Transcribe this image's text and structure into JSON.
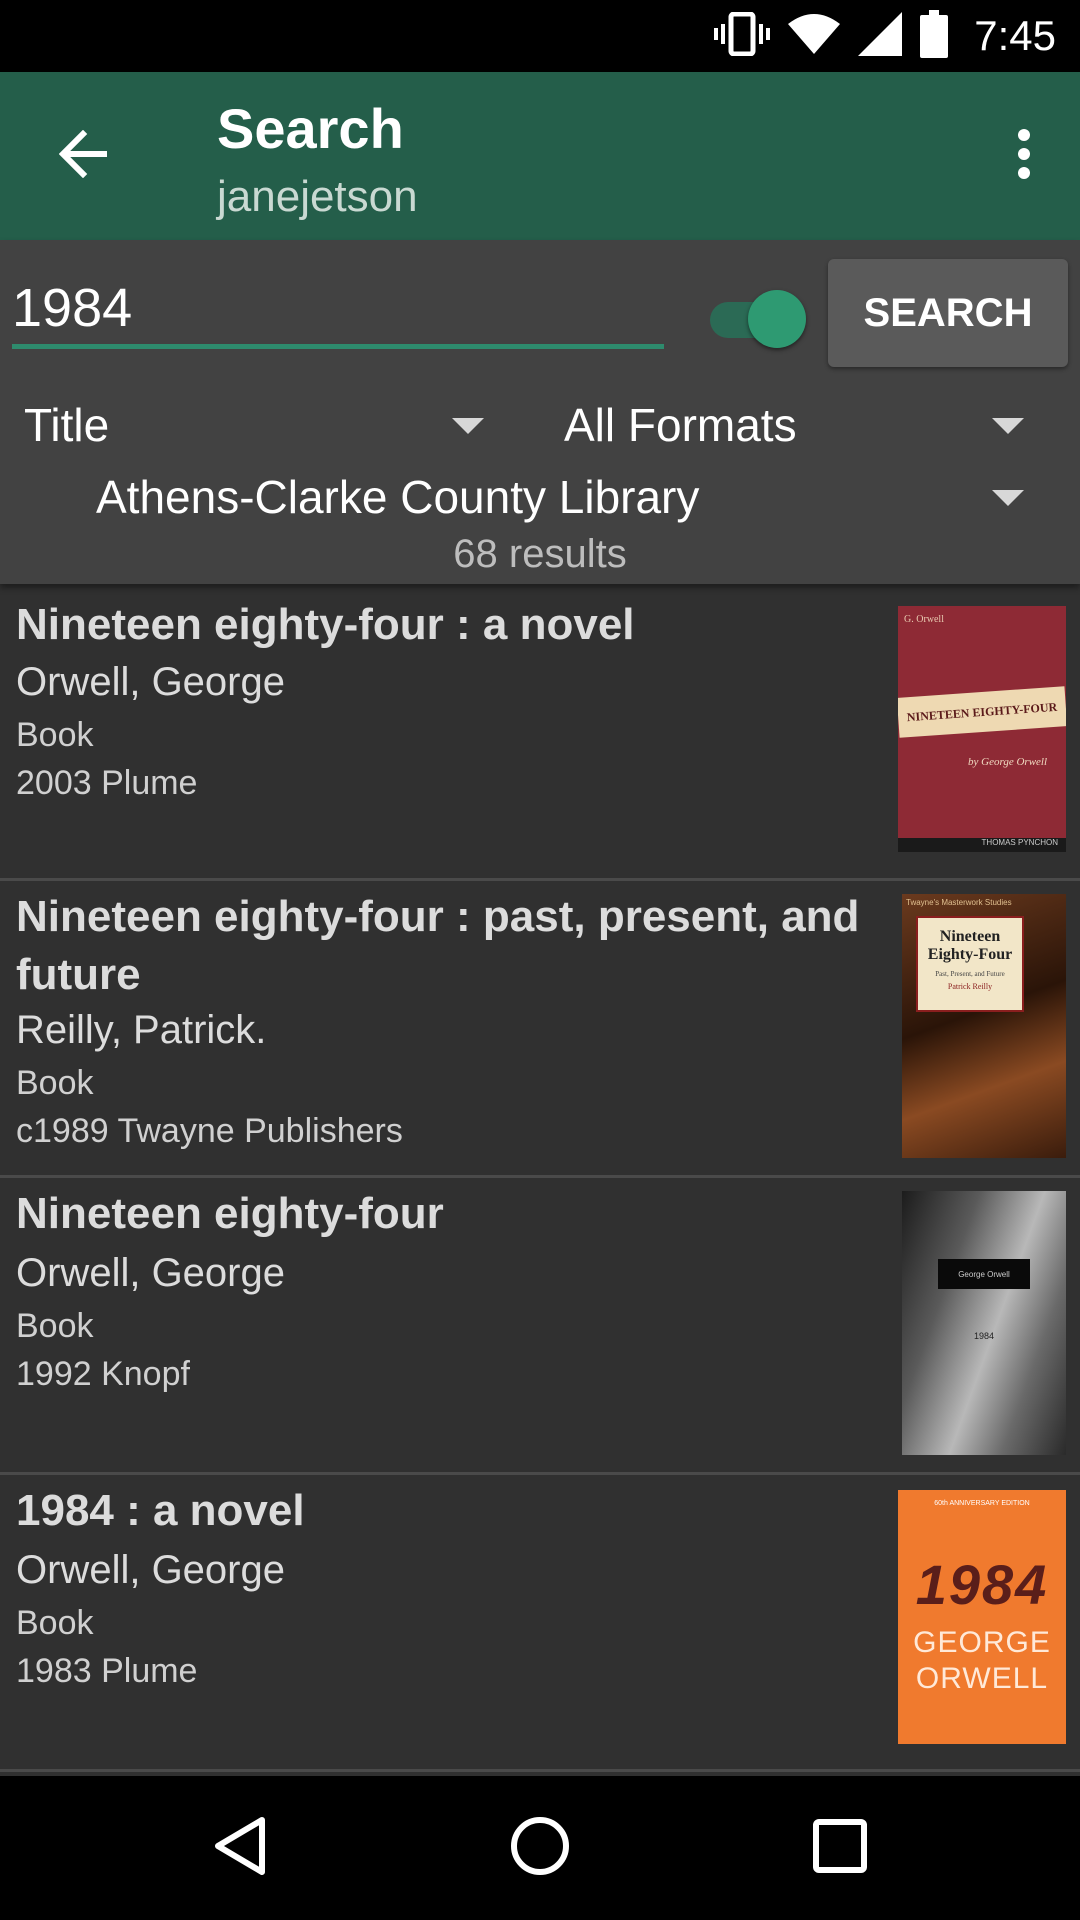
{
  "status_bar": {
    "time": "7:45"
  },
  "app_bar": {
    "title": "Search",
    "subtitle": "janejetson"
  },
  "search": {
    "query": "1984",
    "button_label": "SEARCH",
    "field_dropdown": "Title",
    "format_dropdown": "All Formats",
    "library_dropdown": "Athens-Clarke County Library",
    "results_count": "68 results"
  },
  "results": [
    {
      "title": "Nineteen eighty-four : a novel",
      "author": "Orwell, George",
      "format": "Book",
      "publication": "2003 Plume"
    },
    {
      "title": "Nineteen eighty-four : past, present, and future",
      "author": "Reilly, Patrick.",
      "format": "Book",
      "publication": "c1989 Twayne Publishers"
    },
    {
      "title": "Nineteen eighty-four",
      "author": "Orwell, George",
      "format": "Book",
      "publication": "1992 Knopf"
    },
    {
      "title": "1984 : a novel",
      "author": "Orwell, George",
      "format": "Book",
      "publication": "1983 Plume"
    }
  ],
  "covers": {
    "cover1": {
      "top_text": "G. Orwell",
      "banner": "NINETEEN EIGHTY-FOUR",
      "byline": "by George Orwell",
      "footer": "THOMAS PYNCHON"
    },
    "cover2": {
      "series": "Twayne's Masterwork Studies",
      "title": "Nineteen Eighty-Four",
      "subtitle": "Past, Present, and Future",
      "author": "Patrick Reilly"
    },
    "cover3": {
      "label": "George Orwell",
      "title": "1984"
    },
    "cover4": {
      "top": "60th ANNIVERSARY EDITION",
      "number": "1984",
      "name1": "GEORGE",
      "name2": "ORWELL"
    }
  },
  "colors": {
    "app_bar": "#245E4A",
    "accent": "#2E8B6D",
    "background": "#303030",
    "panel": "#424242"
  }
}
